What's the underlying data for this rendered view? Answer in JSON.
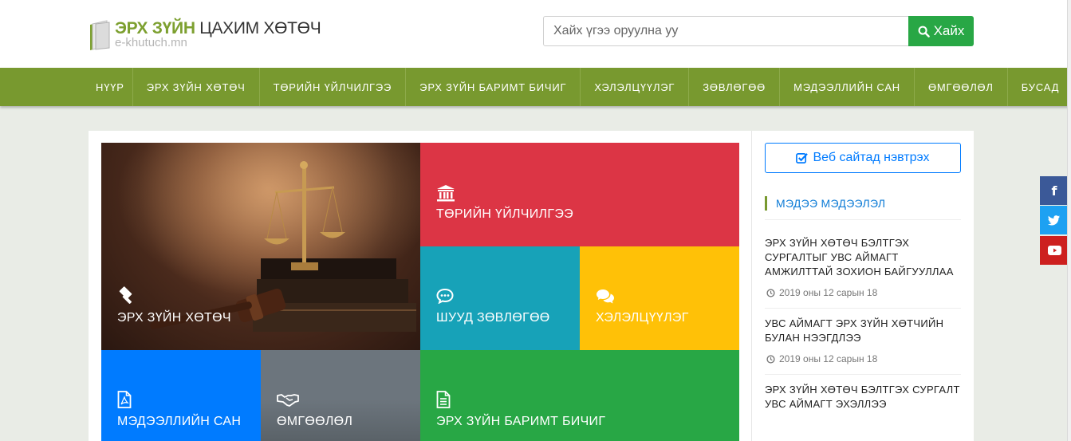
{
  "logo": {
    "title_bold": "ЭРХ ЗҮЙН",
    "title_rest": "ЦАХИМ ХӨТӨЧ",
    "subtitle": "e-khutuch.mn"
  },
  "search": {
    "placeholder": "Хайх үгээ оруулна уу",
    "button_label": "Хайх"
  },
  "nav": {
    "items": [
      {
        "label": "НҮҮР"
      },
      {
        "label": "ЭРХ ЗҮЙН ХӨТӨЧ"
      },
      {
        "label": "ТӨРИЙН ҮЙЛЧИЛГЭЭ"
      },
      {
        "label": "ЭРХ ЗҮЙН БАРИМТ БИЧИГ"
      },
      {
        "label": "ХЭЛЭЛЦҮҮЛЭГ"
      },
      {
        "label": "ЗӨВЛӨГӨӨ"
      },
      {
        "label": "МЭДЭЭЛЛИЙН САН"
      },
      {
        "label": "ӨМГӨӨЛӨЛ"
      },
      {
        "label": "БУСАД"
      }
    ]
  },
  "tiles": {
    "justice": {
      "label": "ЭРХ ЗҮЙН ХӨТӨЧ",
      "icon": "gavel-icon"
    },
    "gov": {
      "label": "ТӨРИЙН ҮЙЛЧИЛГЭЭ",
      "icon": "institution-icon",
      "color": "#dc3545"
    },
    "consult": {
      "label": "ШУУД ЗӨВЛӨГӨӨ",
      "icon": "comment-dots-icon",
      "color": "#17a2b8"
    },
    "discuss": {
      "label": "ХЭЛЭЛЦҮҮЛЭГ",
      "icon": "comments-icon",
      "color": "#ffc107"
    },
    "info": {
      "label": "МЭДЭЭЛЛИЙН САН",
      "icon": "pdf-file-icon",
      "color": "#007bff"
    },
    "defender": {
      "label": "ӨМГӨӨЛӨЛ",
      "icon": "handshake-icon",
      "color": "#6c757d"
    },
    "docs": {
      "label": "ЭРХ ЗҮЙН БАРИМТ БИЧИГ",
      "icon": "file-text-icon",
      "color": "#28a745"
    }
  },
  "sidebar": {
    "login_label": "Веб сайтад нэвтрэх",
    "news_heading": "МЭДЭЭ МЭДЭЭЛЭЛ",
    "news": [
      {
        "title": "ЭРХ ЗҮЙН ХӨТӨЧ БЭЛТГЭХ СУРГАЛТЫГ УВС АЙМАГТ АМЖИЛТТАЙ ЗОХИОН БАЙГУУЛЛАА",
        "date": "2019 оны 12 сарын 18"
      },
      {
        "title": "УВС АЙМАГТ ЭРХ ЗҮЙН ХӨТЧИЙН БУЛАН НЭЭГДЛЭЭ",
        "date": "2019 оны 12 сарын 18"
      },
      {
        "title": "ЭРХ ЗҮЙН ХӨТӨЧ БЭЛТГЭХ СУРГАЛТ УВС АЙМАГТ ЭХЭЛЛЭЭ"
      }
    ]
  },
  "social": [
    {
      "icon": "facebook-icon",
      "glyph": "f",
      "color": "#3b5998"
    },
    {
      "icon": "twitter-icon",
      "color": "#1da1f2"
    },
    {
      "icon": "youtube-icon",
      "color": "#cd201f"
    }
  ]
}
